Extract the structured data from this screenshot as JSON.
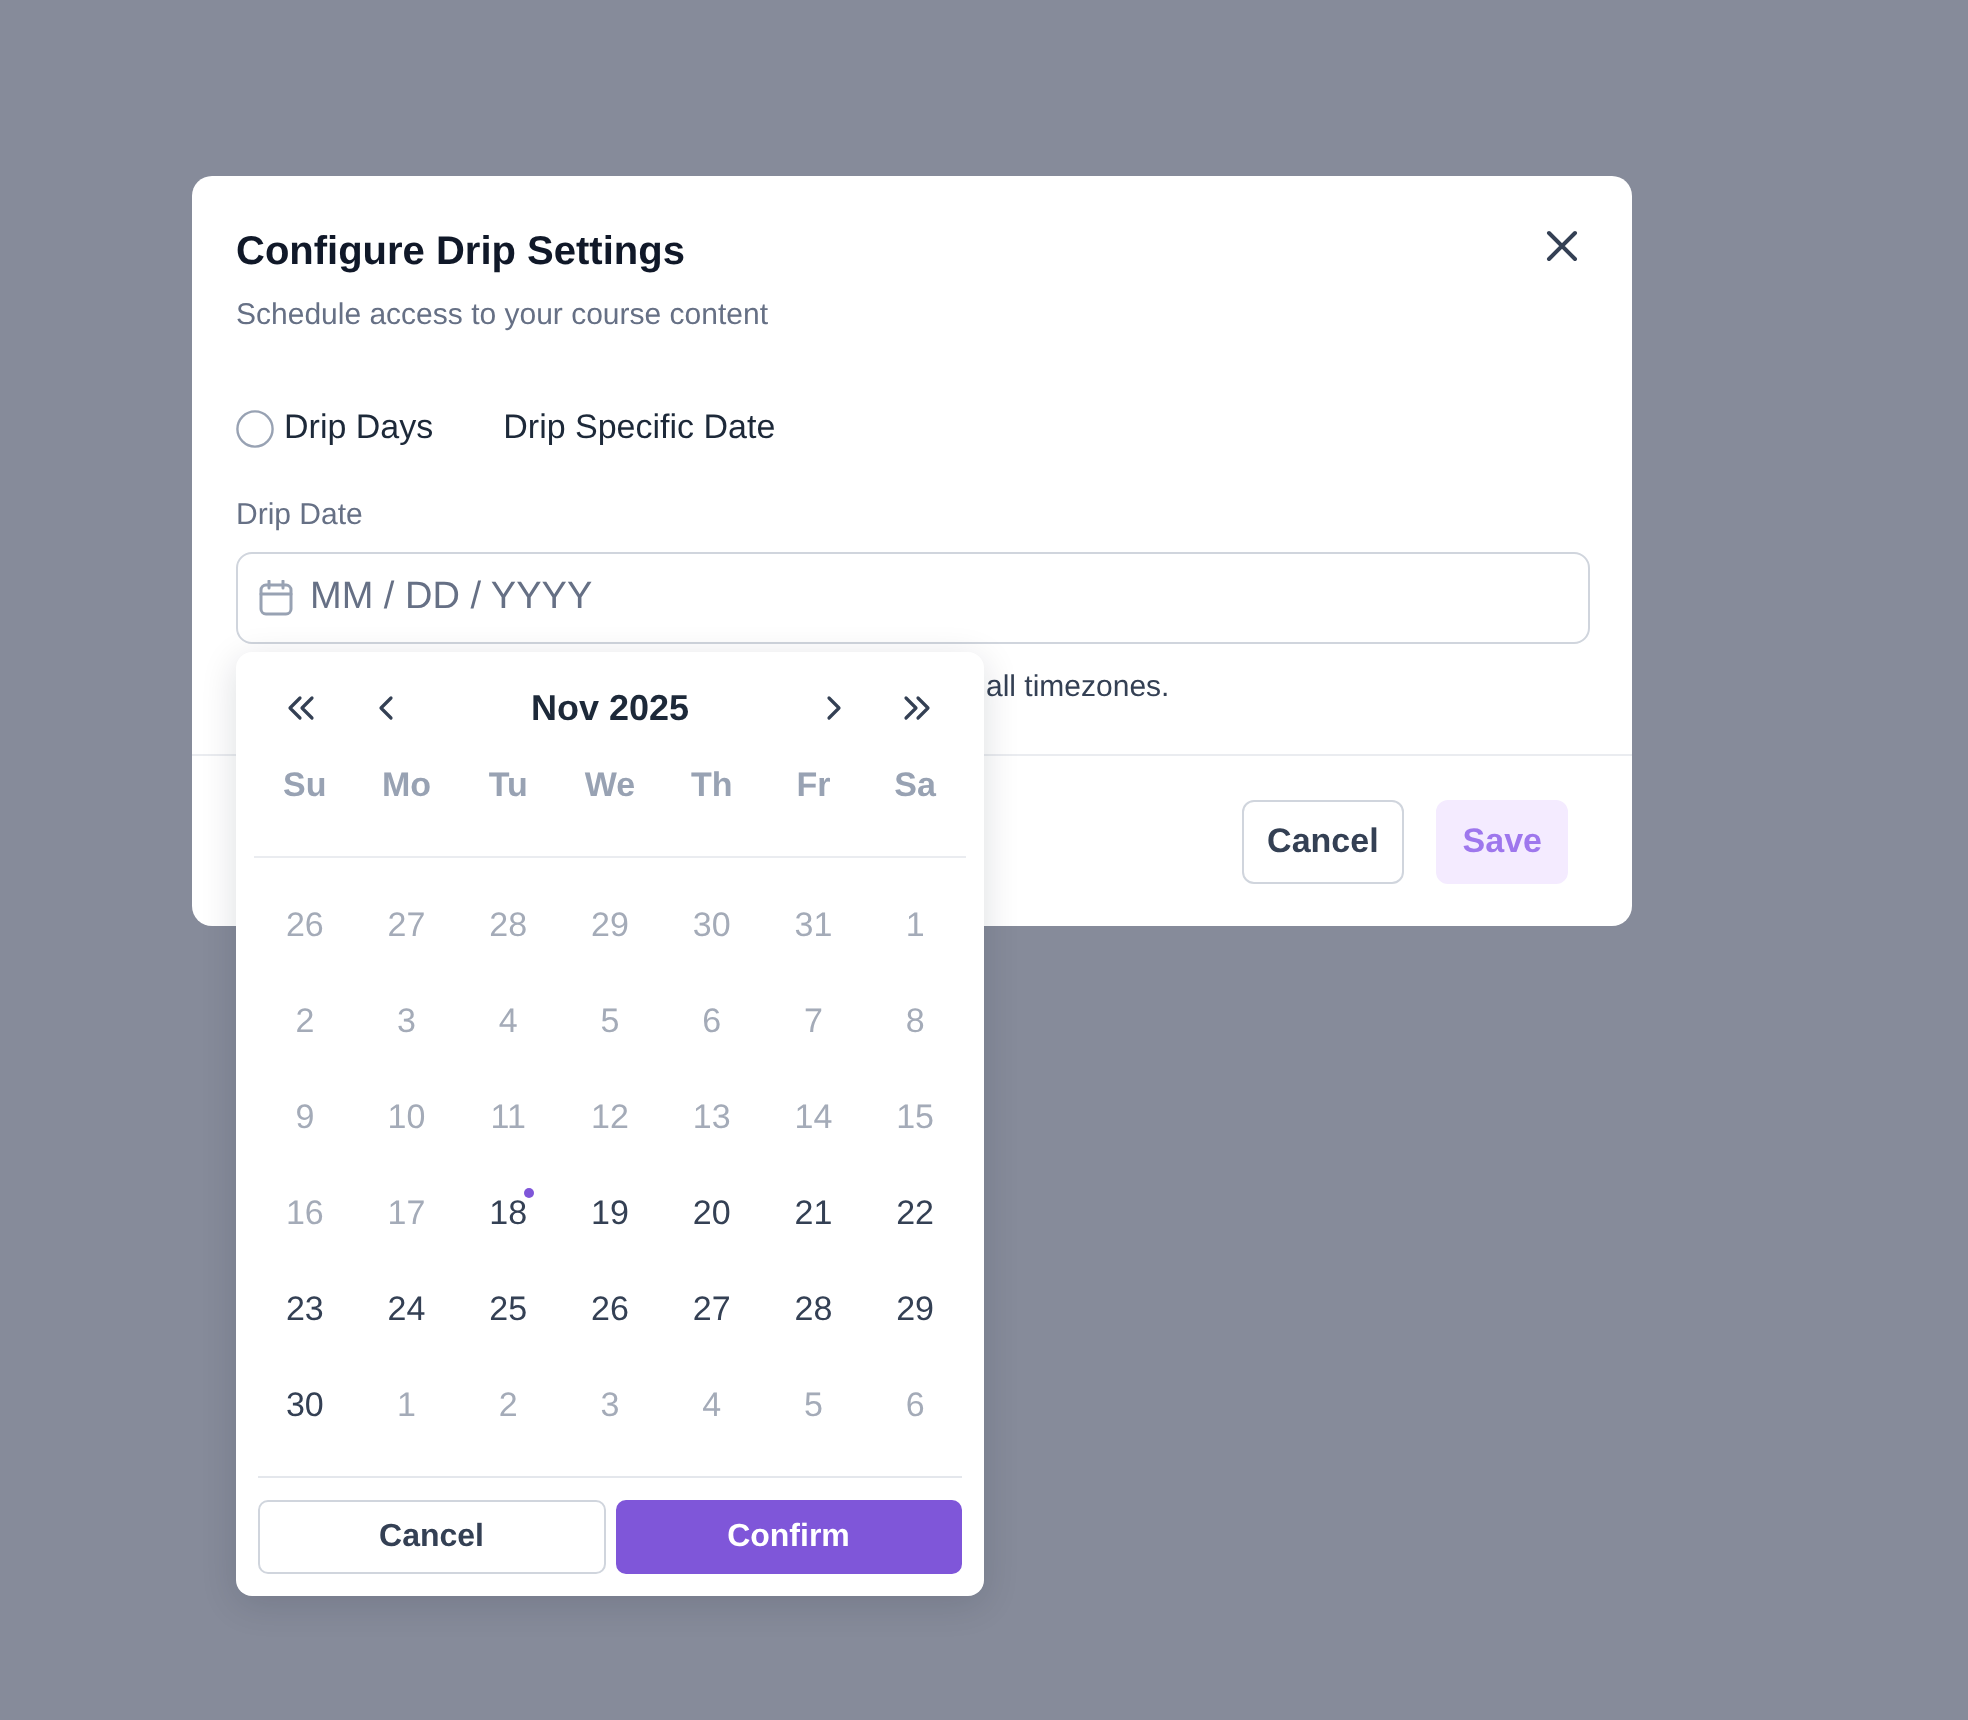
{
  "dialog": {
    "title": "Configure Drip Settings",
    "subtitle": "Schedule access to your course content"
  },
  "options": [
    {
      "kind": "radio",
      "label": "Drip Days",
      "checked": false
    },
    {
      "kind": "text",
      "label": "Drip Specific Date"
    }
  ],
  "date_field": {
    "label": "Drip Date",
    "placeholder": "MM / DD / YYYY",
    "help_text": "all timezones."
  },
  "calendar": {
    "month": "Nov 2025",
    "weekdays": [
      "Su",
      "Mo",
      "Tu",
      "We",
      "Th",
      "Fr",
      "Sa"
    ],
    "days": [
      {
        "label": "26",
        "disabled": true,
        "today": false
      },
      {
        "label": "27",
        "disabled": true,
        "today": false
      },
      {
        "label": "28",
        "disabled": true,
        "today": false
      },
      {
        "label": "29",
        "disabled": true,
        "today": false
      },
      {
        "label": "30",
        "disabled": true,
        "today": false
      },
      {
        "label": "31",
        "disabled": true,
        "today": false
      },
      {
        "label": "1",
        "disabled": true,
        "today": false
      },
      {
        "label": "2",
        "disabled": true,
        "today": false
      },
      {
        "label": "3",
        "disabled": true,
        "today": false
      },
      {
        "label": "4",
        "disabled": true,
        "today": false
      },
      {
        "label": "5",
        "disabled": true,
        "today": false
      },
      {
        "label": "6",
        "disabled": true,
        "today": false
      },
      {
        "label": "7",
        "disabled": true,
        "today": false
      },
      {
        "label": "8",
        "disabled": true,
        "today": false
      },
      {
        "label": "9",
        "disabled": true,
        "today": false
      },
      {
        "label": "10",
        "disabled": true,
        "today": false
      },
      {
        "label": "11",
        "disabled": true,
        "today": false
      },
      {
        "label": "12",
        "disabled": true,
        "today": false
      },
      {
        "label": "13",
        "disabled": true,
        "today": false
      },
      {
        "label": "14",
        "disabled": true,
        "today": false
      },
      {
        "label": "15",
        "disabled": true,
        "today": false
      },
      {
        "label": "16",
        "disabled": true,
        "today": false
      },
      {
        "label": "17",
        "disabled": true,
        "today": false
      },
      {
        "label": "18",
        "disabled": false,
        "today": true
      },
      {
        "label": "19",
        "disabled": false,
        "today": false
      },
      {
        "label": "20",
        "disabled": false,
        "today": false
      },
      {
        "label": "21",
        "disabled": false,
        "today": false
      },
      {
        "label": "22",
        "disabled": false,
        "today": false
      },
      {
        "label": "23",
        "disabled": false,
        "today": false
      },
      {
        "label": "24",
        "disabled": false,
        "today": false
      },
      {
        "label": "25",
        "disabled": false,
        "today": false
      },
      {
        "label": "26",
        "disabled": false,
        "today": false
      },
      {
        "label": "27",
        "disabled": false,
        "today": false
      },
      {
        "label": "28",
        "disabled": false,
        "today": false
      },
      {
        "label": "29",
        "disabled": false,
        "today": false
      },
      {
        "label": "30",
        "disabled": false,
        "today": false
      },
      {
        "label": "1",
        "disabled": true,
        "today": false
      },
      {
        "label": "2",
        "disabled": true,
        "today": false
      },
      {
        "label": "3",
        "disabled": true,
        "today": false
      },
      {
        "label": "4",
        "disabled": true,
        "today": false
      },
      {
        "label": "5",
        "disabled": true,
        "today": false
      },
      {
        "label": "6",
        "disabled": true,
        "today": false
      }
    ],
    "buttons": [
      {
        "label": "Cancel",
        "kind": "secondary"
      },
      {
        "label": "Confirm",
        "kind": "primary"
      }
    ]
  },
  "footer": {
    "buttons": [
      {
        "label": "Cancel",
        "kind": "secondary",
        "disabled": false
      },
      {
        "label": "Save",
        "kind": "primary",
        "disabled": true
      }
    ]
  }
}
